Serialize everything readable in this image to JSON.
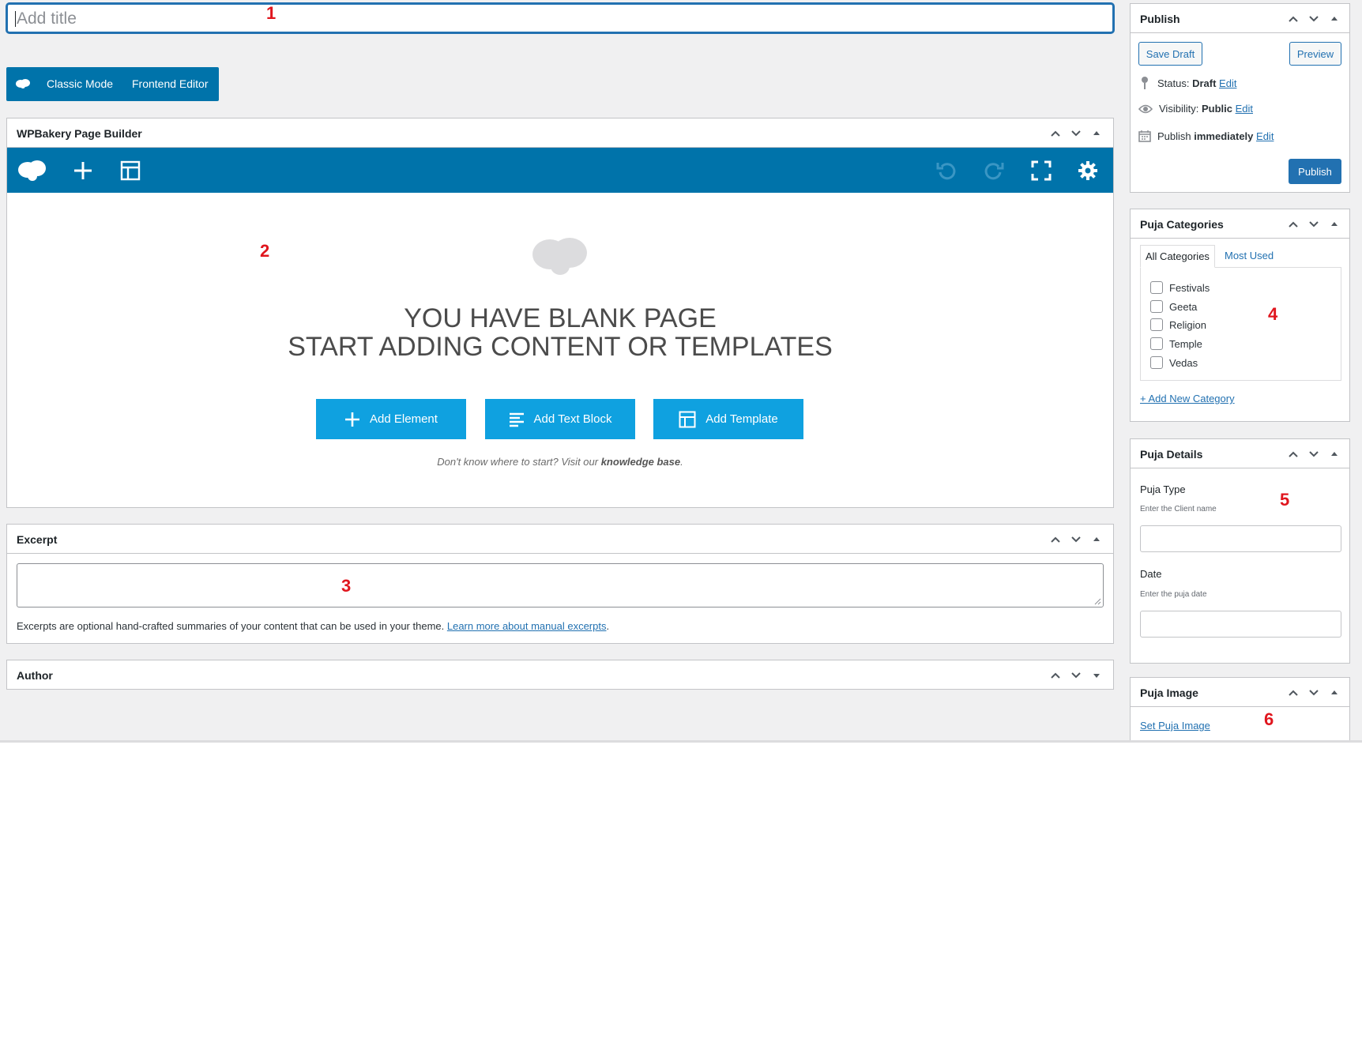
{
  "title_field": {
    "placeholder": "Add title"
  },
  "mode_bar": {
    "classic_mode": "Classic Mode",
    "frontend_editor": "Frontend Editor"
  },
  "page_builder": {
    "title": "WPBakery Page Builder",
    "blank_line1": "YOU HAVE BLANK PAGE",
    "blank_line2": "START ADDING CONTENT OR TEMPLATES",
    "add_element": "Add Element",
    "add_text_block": "Add Text Block",
    "add_template": "Add Template",
    "hint_prefix": "Don't know where to start? Visit our ",
    "hint_link": "knowledge base",
    "hint_suffix": "."
  },
  "excerpt": {
    "title": "Excerpt",
    "help_text": "Excerpts are optional hand-crafted summaries of your content that can be used in your theme. ",
    "help_link": "Learn more about manual excerpts",
    "help_suffix": "."
  },
  "author": {
    "title": "Author"
  },
  "publish": {
    "title": "Publish",
    "save_draft": "Save Draft",
    "preview": "Preview",
    "status_label": "Status: ",
    "status_value": "Draft",
    "visibility_label": "Visibility: ",
    "visibility_value": "Public",
    "publish_label": "Publish ",
    "publish_value": "immediately",
    "edit": "Edit",
    "publish_button": "Publish"
  },
  "categories": {
    "title": "Puja Categories",
    "tab_all": "All Categories",
    "tab_most_used": "Most Used",
    "items": [
      "Festivals",
      "Geeta",
      "Religion",
      "Temple",
      "Vedas"
    ],
    "add_new": "+ Add New Category"
  },
  "details": {
    "title": "Puja Details",
    "type_label": "Puja Type",
    "type_hint": "Enter the Client name",
    "date_label": "Date",
    "date_hint": "Enter the puja date"
  },
  "image": {
    "title": "Puja Image",
    "set_link": "Set Puja Image"
  },
  "markers": [
    "1",
    "2",
    "3",
    "4",
    "5",
    "6"
  ],
  "colors": {
    "accent": "#2271b1",
    "builder_bar": "#0073aa",
    "vc_button": "#0fa1e0",
    "marker": "#e0161e"
  }
}
